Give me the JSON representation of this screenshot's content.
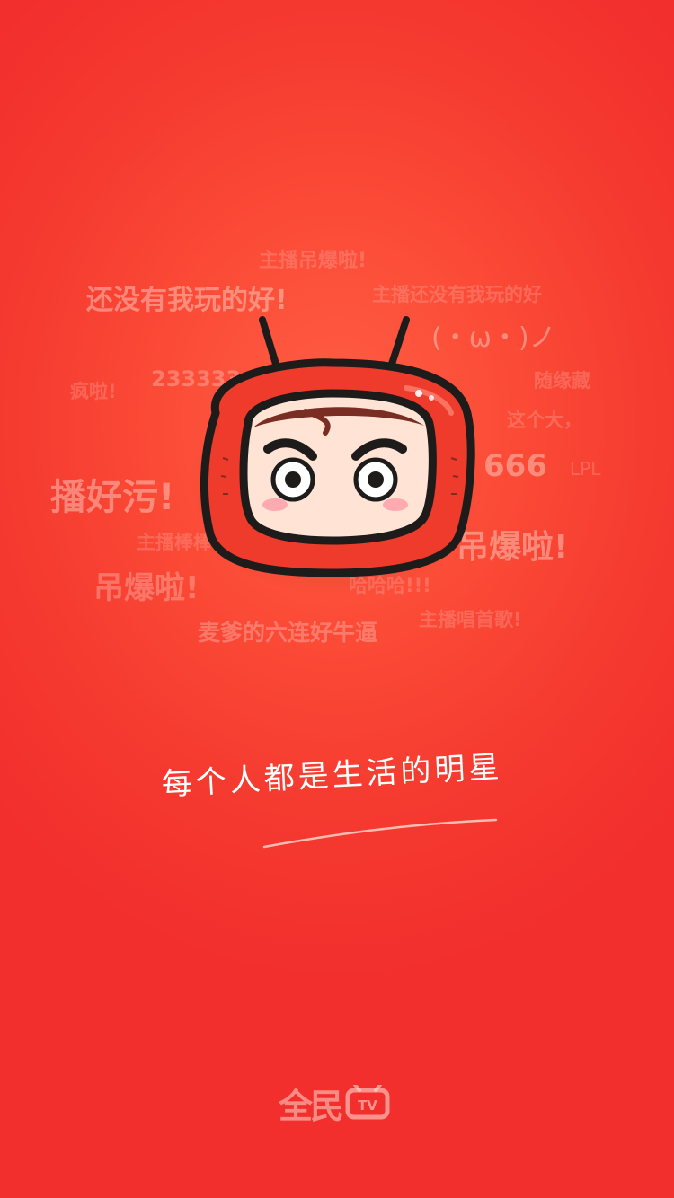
{
  "danmaku": [
    "主播吊爆啦!",
    "还没有我玩的好!",
    "主播还没有我玩的好",
    "(・ω・)ノ",
    "233333",
    "疯啦!",
    "随缘藏",
    "这个大，",
    "666",
    "LPL",
    "播好污!",
    "主播棒棒",
    "吊爆啦!",
    "吊爆啦!",
    "哈哈哈!!!",
    "主播唱首歌!",
    "麦爹的六连好牛逼"
  ],
  "slogan": "每个人都是生活的明星",
  "brand": {
    "name": "全民",
    "suffix": "TV"
  },
  "colors": {
    "background": "#f53a30",
    "mascot_red": "#ee3b2b",
    "mascot_outline": "#1e1b1b"
  },
  "icons": [
    "mascot-tv-icon",
    "brand-tv-icon"
  ]
}
